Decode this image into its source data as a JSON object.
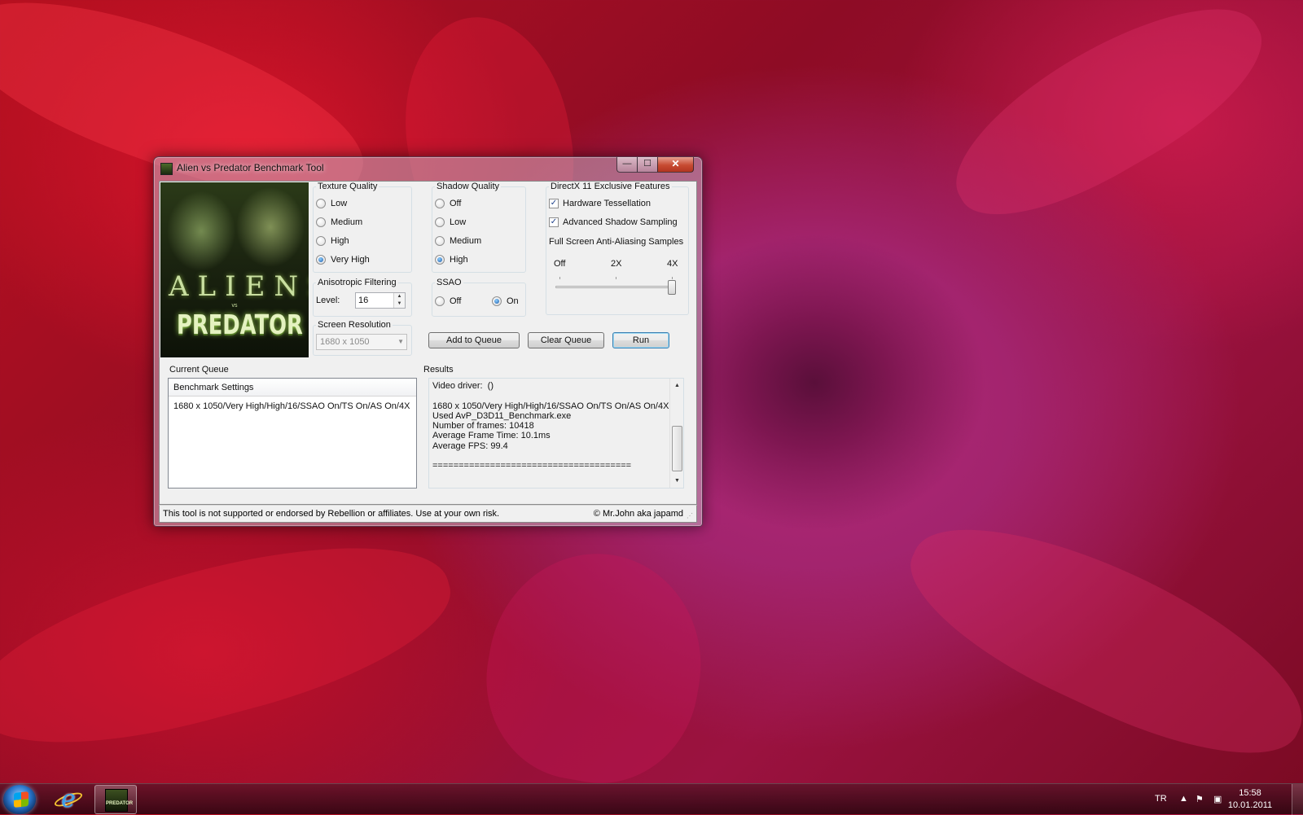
{
  "window": {
    "title": "Alien vs Predator Benchmark Tool",
    "controls": {
      "minimize": "—",
      "maximize": "☐",
      "close": "✕"
    }
  },
  "cover": {
    "line1": "ALIENS",
    "line2": "vs",
    "line3": "PREDATOR"
  },
  "texture_quality": {
    "title": "Texture Quality",
    "options": [
      "Low",
      "Medium",
      "High",
      "Very High"
    ],
    "selected": "Very High"
  },
  "shadow_quality": {
    "title": "Shadow Quality",
    "options": [
      "Off",
      "Low",
      "Medium",
      "High"
    ],
    "selected": "High"
  },
  "dx11": {
    "title": "DirectX 11 Exclusive Features",
    "hardware_tessellation": {
      "label": "Hardware Tessellation",
      "checked": true
    },
    "advanced_shadow_sampling": {
      "label": "Advanced Shadow Sampling",
      "checked": true
    },
    "fsaa_label": "Full Screen Anti-Aliasing Samples",
    "fsaa_ticks": [
      "Off",
      "2X",
      "4X"
    ],
    "fsaa_value": "4X"
  },
  "anisotropic": {
    "title": "Anisotropic Filtering",
    "level_label": "Level:",
    "level_value": "16"
  },
  "ssao": {
    "title": "SSAO",
    "off_label": "Off",
    "on_label": "On",
    "selected": "On"
  },
  "screen_resolution": {
    "title": "Screen Resolution",
    "value": "1680 x 1050"
  },
  "buttons": {
    "add_to_queue": "Add to Queue",
    "clear_queue": "Clear Queue",
    "run": "Run"
  },
  "queue": {
    "title": "Current Queue",
    "column": "Benchmark Settings",
    "rows": [
      "1680 x 1050/Very High/High/16/SSAO On/TS On/AS On/4X"
    ]
  },
  "results": {
    "title": "Results",
    "lines": [
      "Video driver:  ()",
      "",
      "1680 x 1050/Very High/High/16/SSAO On/TS On/AS On/4X",
      "Used AvP_D3D11_Benchmark.exe",
      "Number of frames: 10418",
      "Average Frame Time: 10.1ms",
      "Average FPS: 99.4",
      "",
      "======================================"
    ]
  },
  "status": {
    "disclaimer": "This tool is not supported or endorsed by Rebellion or affiliates. Use at your own risk.",
    "credit": "© Mr.John aka japamd"
  },
  "taskbar": {
    "language": "TR",
    "time": "15:58",
    "date": "10.01.2011",
    "app_thumb": "PREDATOR",
    "ie_glyph": "e"
  }
}
